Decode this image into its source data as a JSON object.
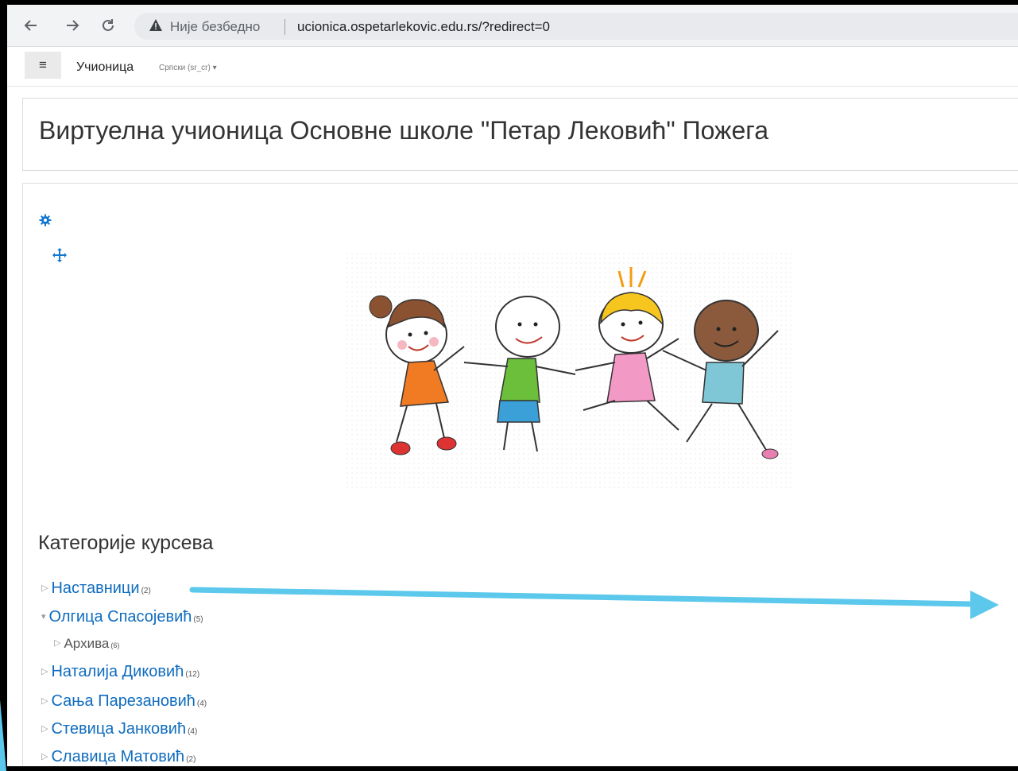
{
  "browser": {
    "back_icon": "arrow-left-icon",
    "forward_icon": "arrow-right-icon",
    "reload_icon": "reload-icon",
    "security_label": "Није безбедно",
    "url": "ucionica.ospetarlekovic.edu.rs/?redirect=0"
  },
  "navbar": {
    "menu_icon": "≡",
    "site_name": "Учионица",
    "language": "Српски (sr_cr)"
  },
  "header": {
    "title": "Виртуелна учионица Основне школе \"Петар Лековић\" Пожега"
  },
  "main": {
    "section_title": "Категорије курсева",
    "categories": [
      {
        "name": "Наставници",
        "count": "(2)",
        "expanded": false
      },
      {
        "name": "Олгица Спасојевић",
        "count": "(5)",
        "expanded": true
      },
      {
        "name": "Архива",
        "count": "(6)",
        "expanded": false
      },
      {
        "name": "Наталија Диковић",
        "count": "(12)",
        "expanded": false
      },
      {
        "name": "Сања Парезановић",
        "count": "(4)",
        "expanded": false
      },
      {
        "name": "Стевица Јанковић",
        "count": "(4)",
        "expanded": false
      },
      {
        "name": "Славица Матовић",
        "count": "(2)",
        "expanded": false
      }
    ]
  },
  "colors": {
    "link": "#0f6cbf",
    "annotation_arrow": "#5bc8ec"
  }
}
